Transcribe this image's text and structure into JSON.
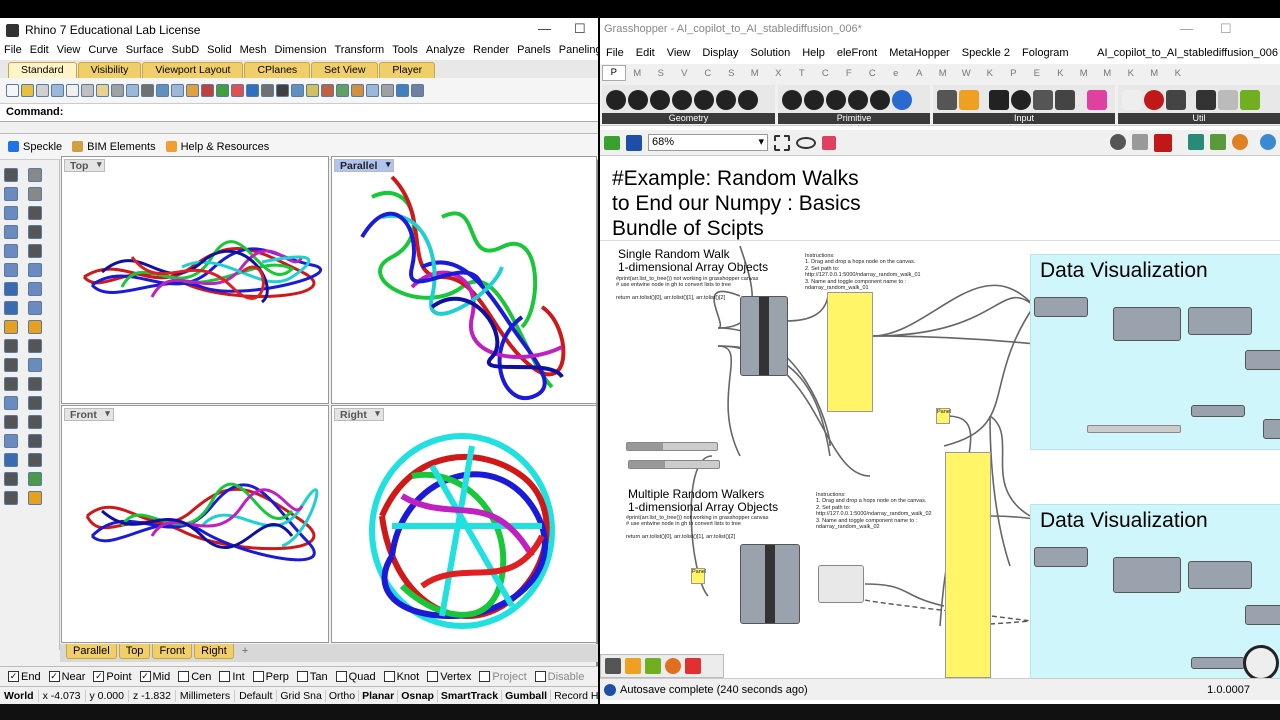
{
  "rhino": {
    "title": "Rhino 7 Educational Lab License",
    "window_min": "—",
    "window_max": "☐",
    "menu": [
      "File",
      "Edit",
      "View",
      "Curve",
      "Surface",
      "SubD",
      "Solid",
      "Mesh",
      "Dimension",
      "Transform",
      "Tools",
      "Analyze",
      "Render",
      "Panels",
      "Paneling Tools"
    ],
    "tabs": [
      "Standard",
      "Visibility",
      "Viewport Layout",
      "CPlanes",
      "Set View",
      "Player"
    ],
    "command_label": "Command:",
    "panels": [
      "Speckle",
      "BIM Elements",
      "Help & Resources"
    ],
    "viewports": {
      "top": "Top",
      "parallel": "Parallel",
      "front": "Front",
      "right": "Right"
    },
    "viewport_tabs": [
      "Parallel",
      "Top",
      "Front",
      "Right",
      "+"
    ],
    "osnaps": [
      {
        "label": "End",
        "checked": true
      },
      {
        "label": "Near",
        "checked": true
      },
      {
        "label": "Point",
        "checked": true
      },
      {
        "label": "Mid",
        "checked": true
      },
      {
        "label": "Cen",
        "checked": false
      },
      {
        "label": "Int",
        "checked": false
      },
      {
        "label": "Perp",
        "checked": false
      },
      {
        "label": "Tan",
        "checked": false
      },
      {
        "label": "Quad",
        "checked": false
      },
      {
        "label": "Knot",
        "checked": false
      },
      {
        "label": "Vertex",
        "checked": false
      },
      {
        "label": "Project",
        "checked": false
      },
      {
        "label": "Disable",
        "checked": false
      }
    ],
    "status": {
      "world": "World",
      "x": "x -4.073",
      "y": "y 0.000",
      "z": "z -1.832",
      "units": "Millimeters",
      "layer": "Default",
      "modes": [
        "Grid Sna",
        "Ortho",
        "Planar",
        "Osnap",
        "SmartTrack",
        "Gumball",
        "Record History"
      ]
    }
  },
  "gh": {
    "title": "Grasshopper - AI_copilot_to_AI_stablediffusion_006*",
    "menu": [
      "File",
      "Edit",
      "View",
      "Display",
      "Solution",
      "Help",
      "eleFront",
      "MetaHopper",
      "Speckle 2",
      "Fologram"
    ],
    "doc_name": "AI_copilot_to_AI_stablediffusion_006",
    "categories": [
      "P",
      "M",
      "S",
      "V",
      "C",
      "S",
      "M",
      "X",
      "T",
      "C",
      "F",
      "C",
      "e",
      "A",
      "M",
      "W",
      "K",
      "P",
      "E",
      "K",
      "M",
      "M",
      "K",
      "M",
      "K"
    ],
    "groups": [
      "Geometry",
      "Primitive",
      "Input",
      "Util"
    ],
    "zoom": "68%",
    "canvas": {
      "heading": [
        "#Example: Random Walks",
        "to End our Numpy : Basics",
        "Bundle of Scipts"
      ],
      "single_title": "Single Random Walk",
      "single_sub": "1-dimensional Array Objects",
      "single_note": [
        "#print(arr.list_to_tree()) not working in grasshopper canvas",
        "# use entwine node in gh to convert lists to tree",
        "",
        "return arr.tolist()[0], arr.tolist()[1], arr.tolist()[2]"
      ],
      "instr1": [
        "Instructions:",
        "1. Drag and drop a hops node on the canvas.",
        "2. Set path to:",
        "http://127.0.0.1:5000/ndarray_random_walk_01",
        "3. Name and toggle  component name to :",
        "ndarray_random_walk_01"
      ],
      "multi_title": "Multiple Random Walkers",
      "multi_sub": "1-dimensional Array Objects",
      "multi_note": [
        "#print(arr.list_to_tree()) not working in grasshopper canvas",
        "# use entwine node in gh to convert lists to tree",
        "",
        "return arr.tolist()[0], arr.tolist()[1], arr.tolist()[2]"
      ],
      "instr2": [
        "Instructions:",
        "1. Drag and drop a hops node on the canvas.",
        "2. Set path to:",
        "http://127.0.0.1:5000/ndarray_random_walk_02",
        "3. Name and toggle  component name to :",
        "ndarray_random_walk_02"
      ],
      "dv_title": "Data Visualization",
      "panel_label": "Panel"
    },
    "status": "Autosave complete (240 seconds ago)",
    "version": "1.0.0007"
  }
}
